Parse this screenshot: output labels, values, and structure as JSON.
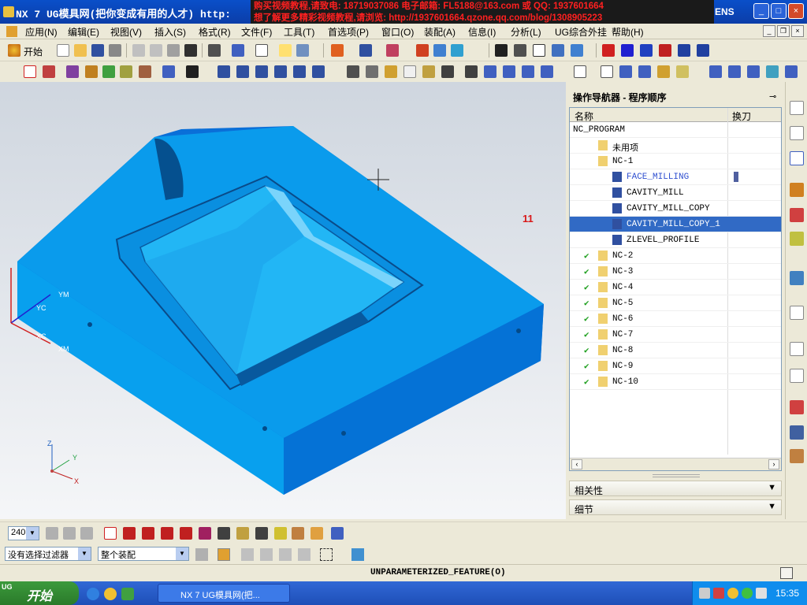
{
  "window": {
    "title": "NX 7 UG模具网(把你变成有用的人才) http:",
    "banner_line1": "购买视频教程,请致电: 18719037086  电子邮箱: FL5188@163.com 或 QQ: 1937601664",
    "banner_line2": "想了解更多精彩视频教程,请浏览: http://1937601664.qzone.qq.com/blog/1308905223",
    "brand": "ENS"
  },
  "menu": {
    "items": [
      "应用(N)",
      "编辑(E)",
      "视图(V)",
      "插入(S)",
      "格式(R)",
      "文件(F)",
      "工具(T)",
      "首选项(P)",
      "窗口(O)",
      "装配(A)",
      "信息(I)",
      "分析(L)",
      "UG综合外挂",
      "帮助(H)"
    ]
  },
  "toolbar": {
    "start_label": "开始"
  },
  "viewport": {
    "marker_label": "11",
    "triad_labels": [
      "YM",
      "YC",
      "XC",
      "XM"
    ],
    "small_axes": [
      "Z",
      "Y",
      "X"
    ]
  },
  "navigator": {
    "title": "操作导航器 - 程序顺序",
    "col_name": "名称",
    "col_tool": "换刀",
    "rows": [
      {
        "label": "NC_PROGRAM",
        "indent": 0
      },
      {
        "label": "未用项",
        "indent": 1
      },
      {
        "label": "NC-1",
        "indent": 1
      },
      {
        "label": "FACE_MILLING",
        "indent": 2
      },
      {
        "label": "CAVITY_MILL",
        "indent": 2
      },
      {
        "label": "CAVITY_MILL_COPY",
        "indent": 2
      },
      {
        "label": "CAVITY_MILL_COPY_1",
        "indent": 2
      },
      {
        "label": "ZLEVEL_PROFILE",
        "indent": 2
      },
      {
        "label": "NC-2",
        "indent": 1
      },
      {
        "label": "NC-3",
        "indent": 1
      },
      {
        "label": "NC-4",
        "indent": 1
      },
      {
        "label": "NC-5",
        "indent": 1
      },
      {
        "label": "NC-6",
        "indent": 1
      },
      {
        "label": "NC-7",
        "indent": 1
      },
      {
        "label": "NC-8",
        "indent": 1
      },
      {
        "label": "NC-9",
        "indent": 1
      },
      {
        "label": "NC-10",
        "indent": 1
      }
    ],
    "selected": "CAVITY_MILL_COPY_1",
    "section_related": "相关性",
    "section_details": "细节"
  },
  "bottom": {
    "zoom_value": "240",
    "filter": "没有选择过滤器",
    "assembly": "整个装配",
    "status": "UNPARAMETERIZED_FEATURE(O)"
  },
  "taskbar": {
    "start": "开始",
    "task_label": "NX 7 UG模具网(把...",
    "clock": "15:35",
    "ug_label": "UG"
  }
}
